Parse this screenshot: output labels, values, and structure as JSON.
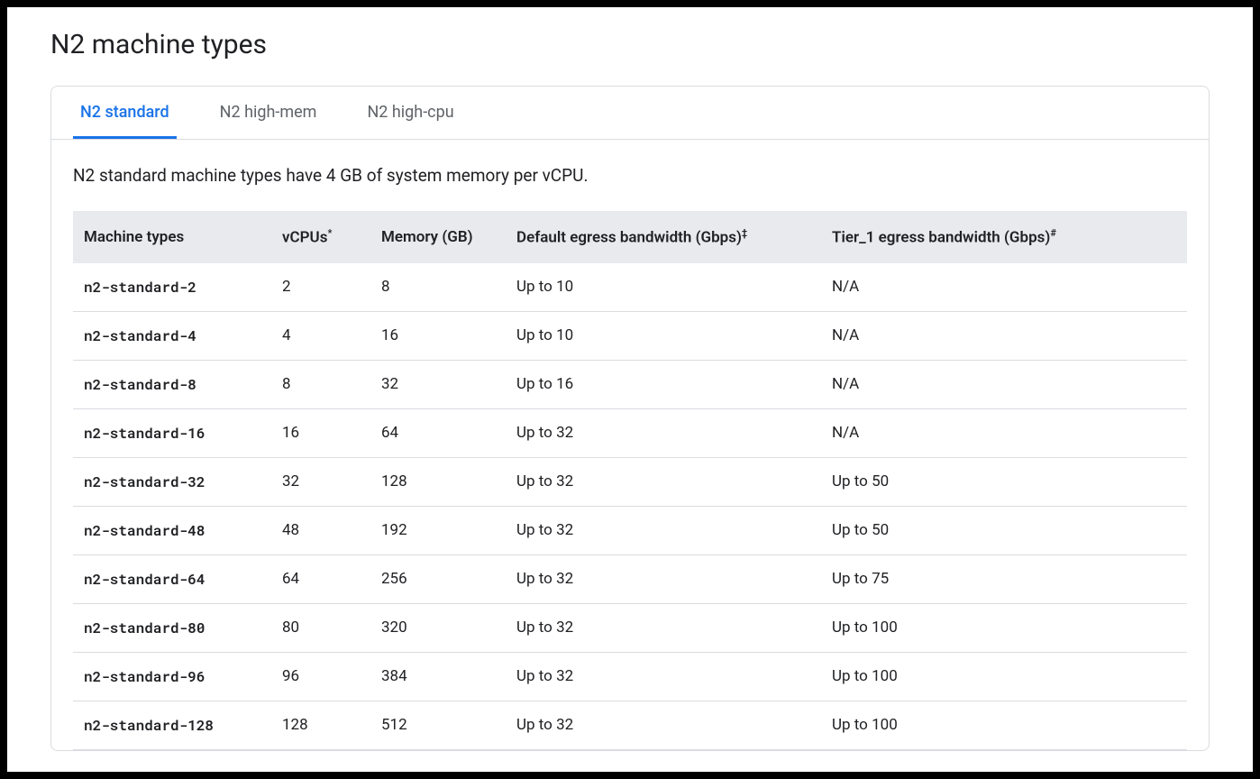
{
  "title": "N2 machine types",
  "tabs": [
    {
      "label": "N2 standard",
      "active": true
    },
    {
      "label": "N2 high-mem",
      "active": false
    },
    {
      "label": "N2 high-cpu",
      "active": false
    }
  ],
  "description": "N2 standard machine types have 4 GB of system memory per vCPU.",
  "table": {
    "headers": [
      {
        "label": "Machine types",
        "sup": ""
      },
      {
        "label": "vCPUs",
        "sup": "*"
      },
      {
        "label": "Memory (GB)",
        "sup": ""
      },
      {
        "label": "Default egress bandwidth (Gbps)",
        "sup": "‡"
      },
      {
        "label": "Tier_1 egress bandwidth (Gbps)",
        "sup": "#"
      }
    ],
    "rows": [
      {
        "name": "n2-standard-2",
        "vcpus": "2",
        "memory": "8",
        "default_bw": "Up to 10",
        "tier1_bw": "N/A"
      },
      {
        "name": "n2-standard-4",
        "vcpus": "4",
        "memory": "16",
        "default_bw": "Up to 10",
        "tier1_bw": "N/A"
      },
      {
        "name": "n2-standard-8",
        "vcpus": "8",
        "memory": "32",
        "default_bw": "Up to 16",
        "tier1_bw": "N/A"
      },
      {
        "name": "n2-standard-16",
        "vcpus": "16",
        "memory": "64",
        "default_bw": "Up to 32",
        "tier1_bw": "N/A"
      },
      {
        "name": "n2-standard-32",
        "vcpus": "32",
        "memory": "128",
        "default_bw": "Up to 32",
        "tier1_bw": "Up to 50"
      },
      {
        "name": "n2-standard-48",
        "vcpus": "48",
        "memory": "192",
        "default_bw": "Up to 32",
        "tier1_bw": "Up to 50"
      },
      {
        "name": "n2-standard-64",
        "vcpus": "64",
        "memory": "256",
        "default_bw": "Up to 32",
        "tier1_bw": "Up to 75"
      },
      {
        "name": "n2-standard-80",
        "vcpus": "80",
        "memory": "320",
        "default_bw": "Up to 32",
        "tier1_bw": "Up to 100"
      },
      {
        "name": "n2-standard-96",
        "vcpus": "96",
        "memory": "384",
        "default_bw": "Up to 32",
        "tier1_bw": "Up to 100"
      },
      {
        "name": "n2-standard-128",
        "vcpus": "128",
        "memory": "512",
        "default_bw": "Up to 32",
        "tier1_bw": "Up to 100"
      }
    ]
  }
}
